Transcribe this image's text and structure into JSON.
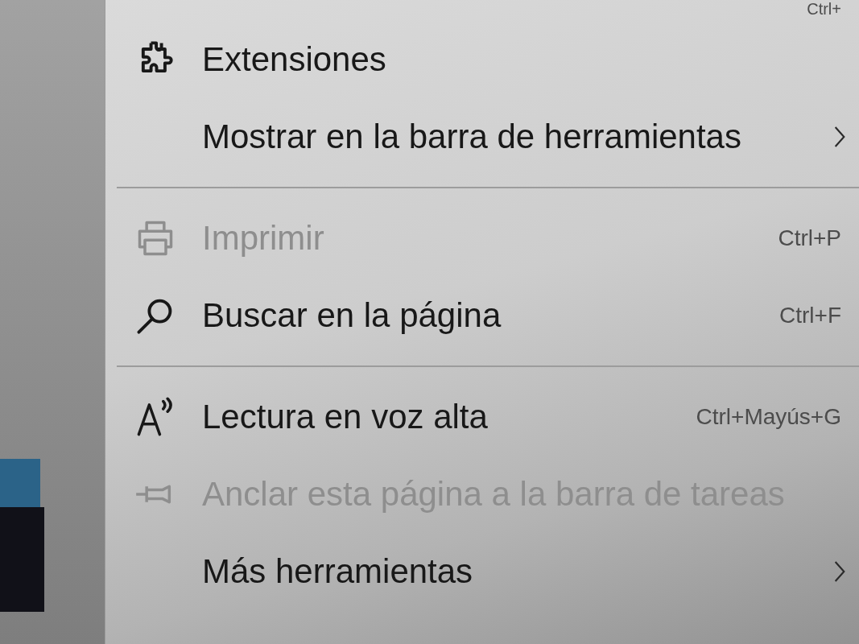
{
  "menu": {
    "cut_off_row": {
      "shortcut": "Ctrl+"
    },
    "items": [
      {
        "kind": "extensions",
        "label": "Extensiones",
        "disabled": false,
        "submenu": false
      },
      {
        "kind": "toolbar",
        "label": "Mostrar en la barra de herramientas",
        "disabled": false,
        "submenu": true
      },
      {
        "kind": "separator"
      },
      {
        "kind": "print",
        "label": "Imprimir",
        "shortcut": "Ctrl+P",
        "disabled": true,
        "submenu": false
      },
      {
        "kind": "find",
        "label": "Buscar en la página",
        "shortcut": "Ctrl+F",
        "disabled": false,
        "submenu": false
      },
      {
        "kind": "separator"
      },
      {
        "kind": "readaloud",
        "label": "Lectura en voz alta",
        "shortcut": "Ctrl+Mayús+G",
        "disabled": false,
        "submenu": false
      },
      {
        "kind": "pin",
        "label": "Anclar esta página a la barra de tareas",
        "disabled": true,
        "submenu": false
      },
      {
        "kind": "tools",
        "label": "Más herramientas",
        "disabled": false,
        "submenu": true
      }
    ]
  }
}
